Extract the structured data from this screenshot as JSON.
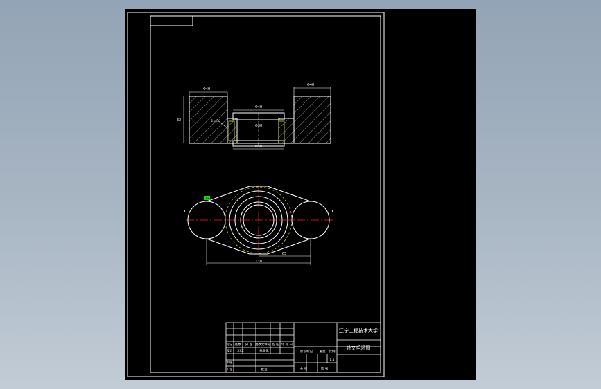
{
  "title_block": {
    "school": "辽宁工程技术大学",
    "drawing_name": "铣叉毛坯图",
    "row_headers": [
      "标记",
      "处数",
      "分 区",
      "更改文件号",
      "签 名",
      "年.月.日"
    ],
    "design_label": "设计",
    "design_value": "XXX",
    "std_label": "标准化",
    "review_label": "审核",
    "process_label": "工艺",
    "approve_label": "批准",
    "stage_label": "阶段标记",
    "weight_label": "重量",
    "scale_label": "比例",
    "scale_value": "1:1",
    "sheet_total": "共 张",
    "sheet_index": "第 张"
  },
  "section_view": {
    "dim_left_width": "Φ40",
    "dim_right_width": "Φ40",
    "dim_bore_top": "Φ40",
    "dim_bore_bottom": "Φ50",
    "dim_hole": "Φ30",
    "dim_height": "32",
    "dim_left_small": "2×45°"
  },
  "plan_view": {
    "dim_overall": "130",
    "dim_half": "65",
    "roughness_mark": "Ra"
  },
  "colors": {
    "background": "#000000",
    "lines": "#ffffff",
    "centerline": "#ff2020",
    "construction": "#e6e600",
    "marker": "#19d119"
  }
}
